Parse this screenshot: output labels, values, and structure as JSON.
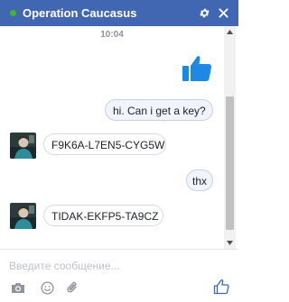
{
  "header": {
    "title": "Operation Caucasus",
    "status": "online",
    "status_color": "#42b72a",
    "bar_color": "#4267b2",
    "icons": [
      "gear-icon",
      "close-icon"
    ]
  },
  "conversation": {
    "timestamp": "10:04",
    "sticker": "like-thumb",
    "messages": [
      {
        "direction": "outgoing",
        "text": "hi. Can i get a key?"
      },
      {
        "direction": "incoming",
        "text": "F9K6A-L7EN5-CYG5W"
      },
      {
        "direction": "outgoing",
        "text": "thx"
      },
      {
        "direction": "incoming",
        "text": "TIDAK-EKFP5-TA9CZ"
      }
    ]
  },
  "composer": {
    "placeholder": "Введите сообщение...",
    "value": "",
    "tools": [
      "camera-icon",
      "emoji-icon",
      "attach-icon",
      "like-icon"
    ]
  },
  "colors": {
    "accent": "#4267b2",
    "like": "#1e88e5",
    "bubble_outgoing_bg": "#f1f4fb",
    "bubble_incoming_bg": "#ffffff"
  }
}
